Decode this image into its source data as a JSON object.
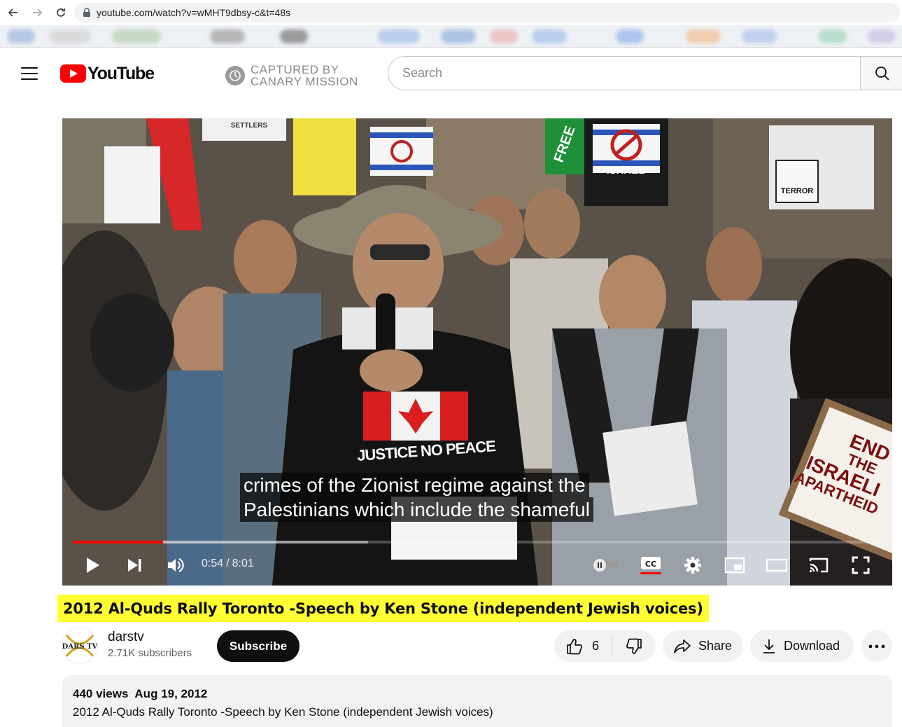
{
  "browser": {
    "url": "youtube.com/watch?v=wMHT9dbsy-c&t=48s"
  },
  "header": {
    "logo_text": "YouTube",
    "watermark_line1": "CAPTURED BY",
    "watermark_line2": "CANARY MISSION",
    "search_placeholder": "Search"
  },
  "player": {
    "caption_line1": "crimes of the Zionist regime against the",
    "caption_line2": "Palestinians which include the shameful",
    "current_time": "0:54",
    "time_separator": "/",
    "duration": "8:01",
    "progress_fraction": 0.112,
    "buffered_fraction": 0.365,
    "captions_enabled": true,
    "autoplay_enabled": false
  },
  "scene_text": {
    "sign_settlers": "SETTLERS",
    "sign_israel": "ISRAEL",
    "sign_free": "FREE",
    "sign_terror": "TERROR",
    "shirt_text": "JUSTICE NO PEACE",
    "sign_end_1": "END",
    "sign_end_2": "THE",
    "sign_end_3": "ISRAELI",
    "sign_end_4": "APARTHEID"
  },
  "video": {
    "title": "2012 Al-Quds Rally Toronto -Speech by Ken Stone (independent Jewish voices)"
  },
  "channel": {
    "name": "darstv",
    "subscribers": "2.71K subscribers",
    "avatar_text": "DARS TV",
    "subscribe_label": "Subscribe"
  },
  "actions": {
    "like_count": "6",
    "share_label": "Share",
    "download_label": "Download"
  },
  "description": {
    "views": "440 views",
    "date": "Aug 19, 2012",
    "text": "2012 Al-Quds Rally Toronto -Speech by Ken Stone (independent Jewish voices)"
  },
  "colors": {
    "accent_red": "#ff0000",
    "title_highlight": "#ffff33"
  }
}
